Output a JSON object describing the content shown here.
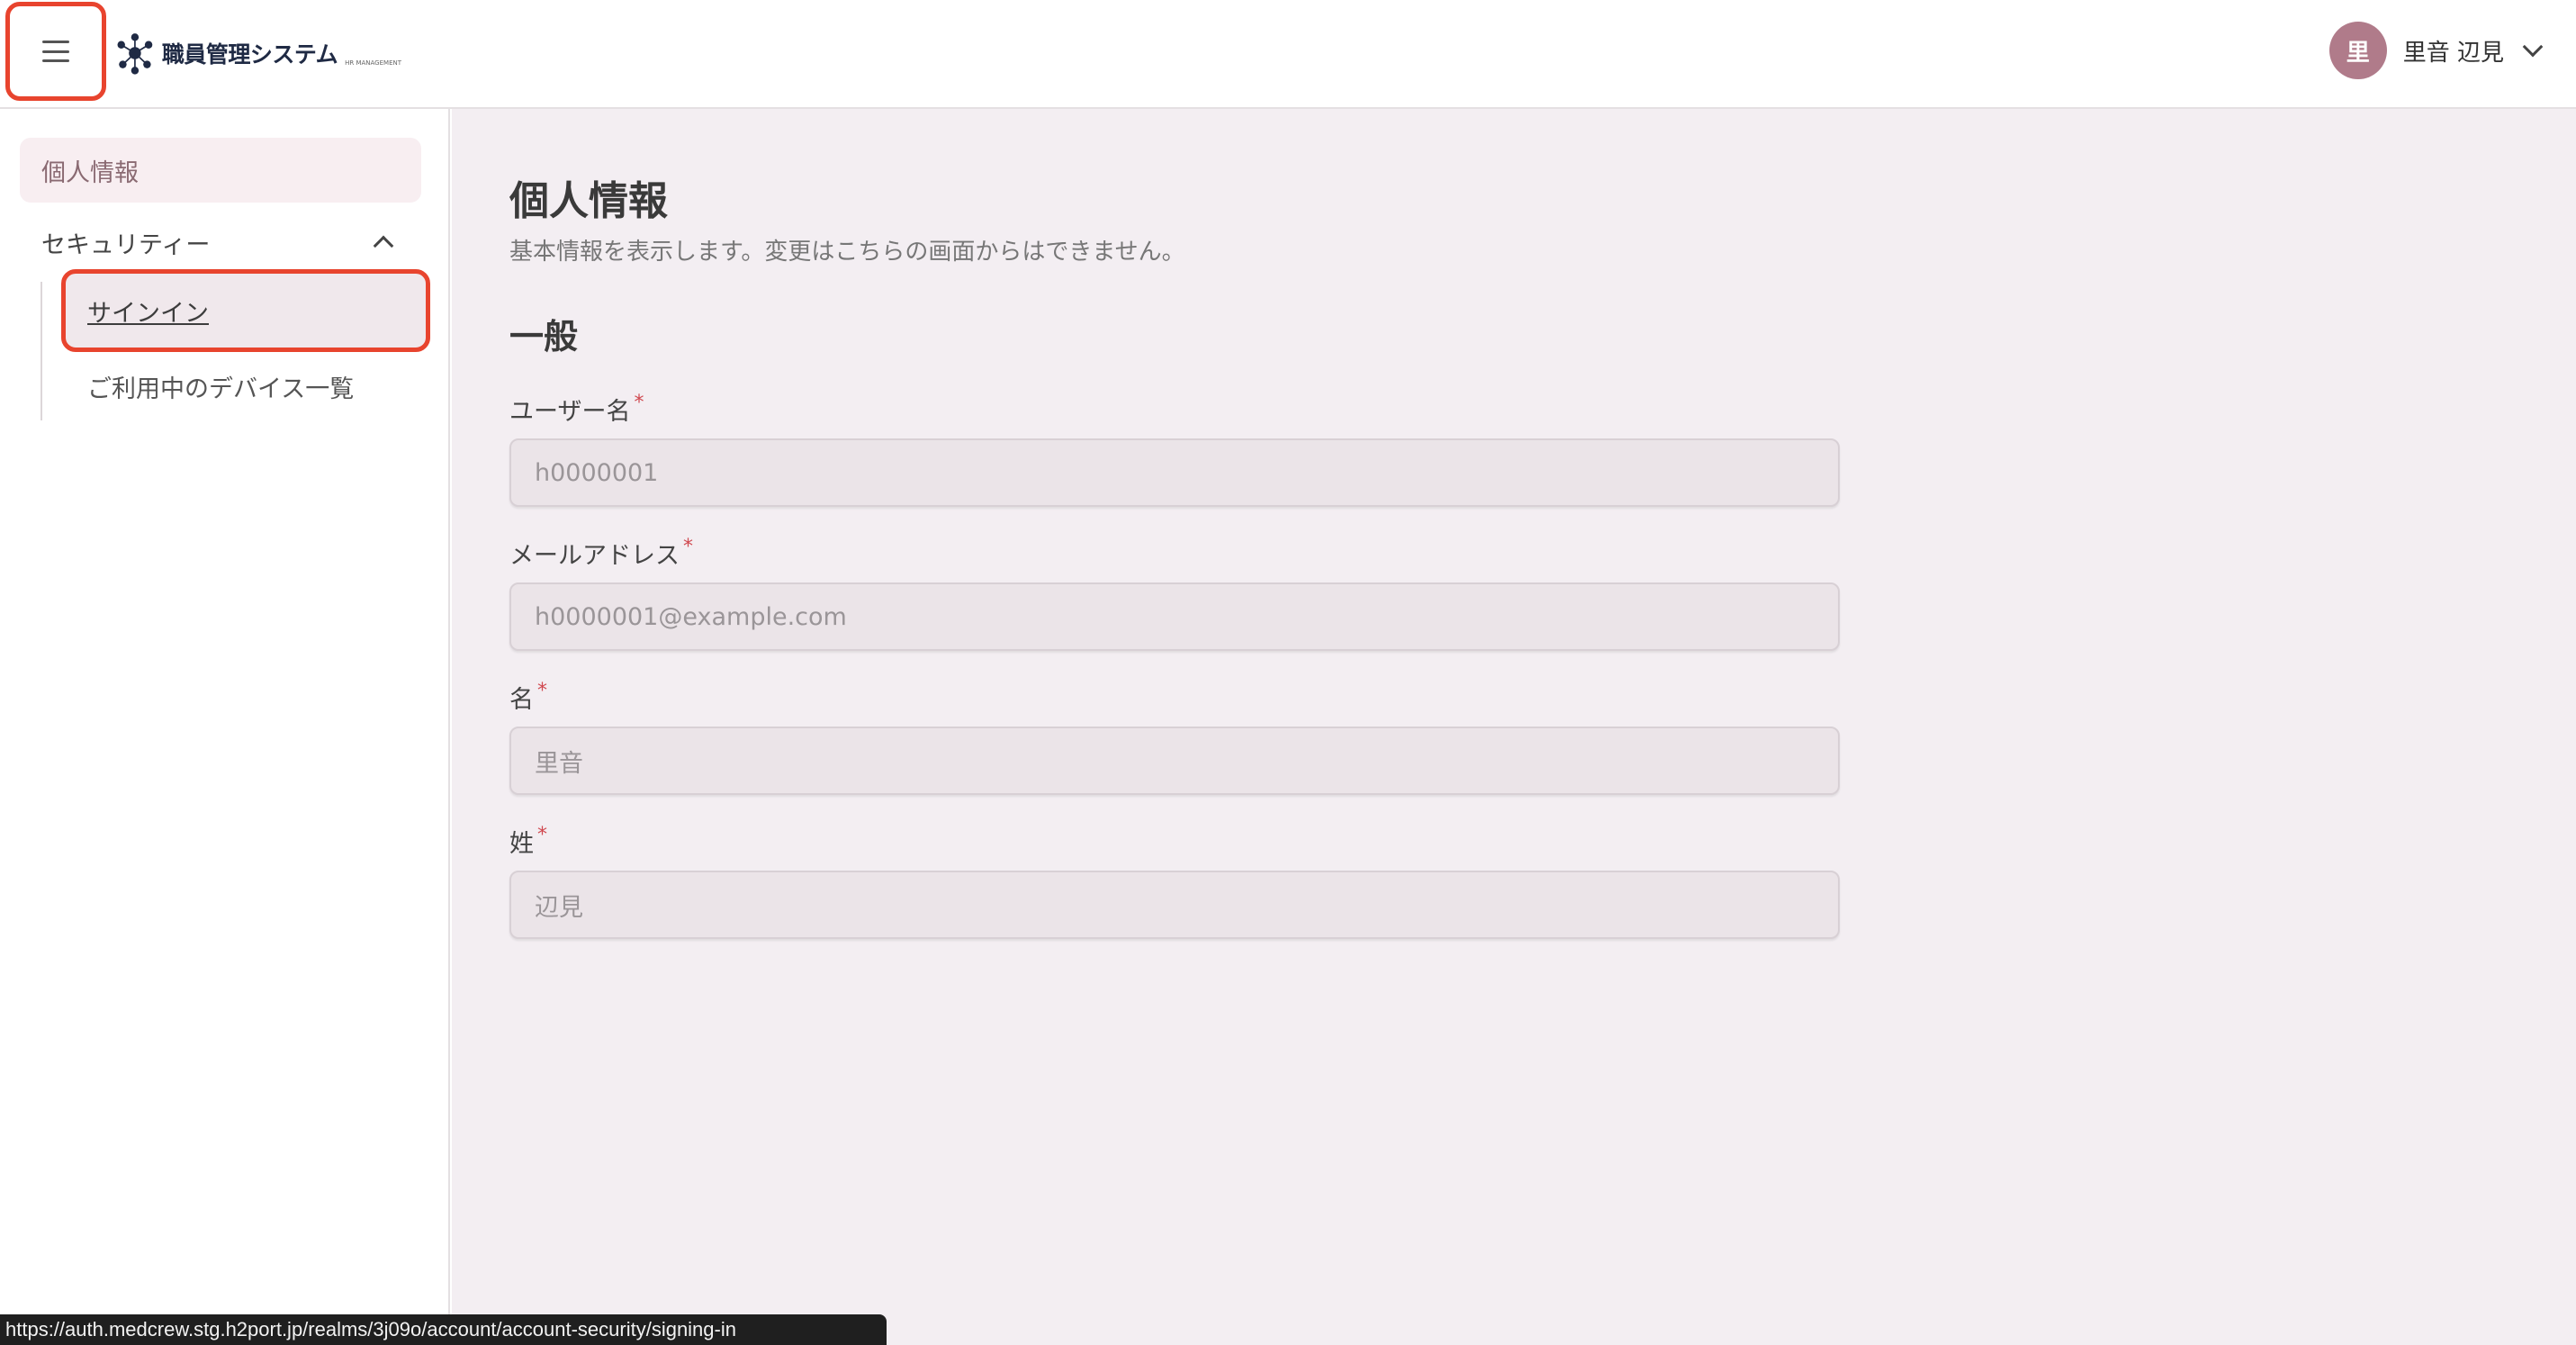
{
  "header": {
    "logo_text": "職員管理システム",
    "logo_sub": "HR MANAGEMENT",
    "user": {
      "avatar_initial": "里",
      "name": "里音 辺見"
    }
  },
  "sidebar": {
    "personal_info": "個人情報",
    "security_group": "セキュリティー",
    "signin": "サインイン",
    "devices": "ご利用中のデバイス一覧"
  },
  "main": {
    "title": "個人情報",
    "description": "基本情報を表示します。変更はこちらの画面からはできません。",
    "section": "一般",
    "fields": {
      "username": {
        "label": "ユーザー名",
        "value": "h0000001"
      },
      "email": {
        "label": "メールアドレス",
        "value": "h0000001@example.com"
      },
      "first_name": {
        "label": "名",
        "value": "里音"
      },
      "last_name": {
        "label": "姓",
        "value": "辺見"
      }
    },
    "required_mark": "*"
  },
  "status_url": "https://auth.medcrew.stg.h2port.jp/realms/3j09o/account/account-security/signing-in",
  "colors": {
    "highlight_border": "#e8442e",
    "avatar_bg": "#b07b8a",
    "main_bg": "#f3eef2",
    "required": "#d0484f"
  }
}
